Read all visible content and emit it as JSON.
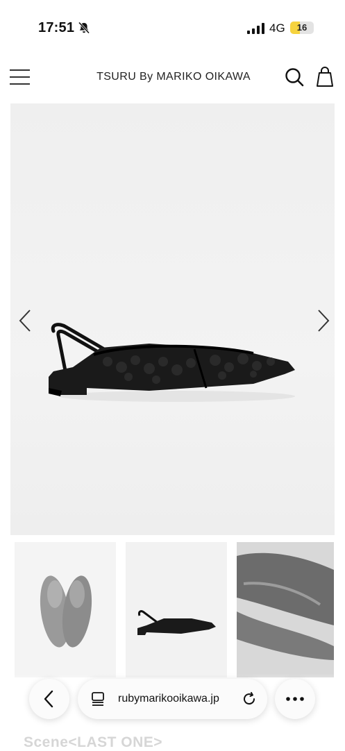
{
  "status_bar": {
    "time": "17:51",
    "network": "4G",
    "battery": "16"
  },
  "header": {
    "brand": "TSURU By MARIKO OIKAWA"
  },
  "browser": {
    "url": "rubymarikooikawa.jp"
  },
  "below_fold": {
    "title": "Scene<LAST ONE>"
  },
  "icons": {
    "menu": "hamburger-icon",
    "search": "search-icon",
    "bag": "shopping-bag-icon",
    "prev": "chevron-left-icon",
    "next": "chevron-right-icon",
    "back": "back-arrow-icon",
    "tabs": "tabs-icon",
    "reload": "reload-icon",
    "more": "more-icon",
    "silent": "bell-slash-icon",
    "signal": "signal-icon"
  },
  "colors": {
    "battery_accent": "#f6d33e",
    "image_bg": "#f0f0f0",
    "text": "#111111"
  }
}
